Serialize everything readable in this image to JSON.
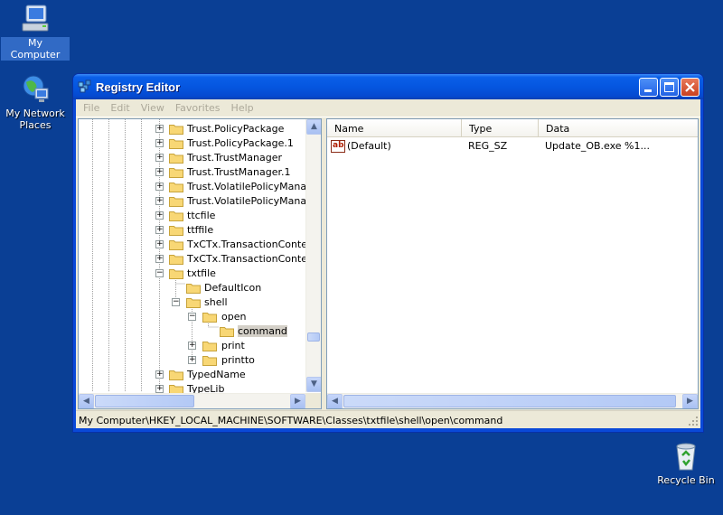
{
  "desktop": {
    "icons": [
      {
        "label": "My Computer"
      },
      {
        "label": "My Network Places"
      },
      {
        "label": "Recycle Bin"
      }
    ]
  },
  "window": {
    "title": "Registry Editor",
    "menu": [
      "File",
      "Edit",
      "View",
      "Favorites",
      "Help"
    ]
  },
  "tree": {
    "items": [
      {
        "label": "Trust.PolicyPackage"
      },
      {
        "label": "Trust.PolicyPackage.1"
      },
      {
        "label": "Trust.TrustManager"
      },
      {
        "label": "Trust.TrustManager.1"
      },
      {
        "label": "Trust.VolatilePolicyManager"
      },
      {
        "label": "Trust.VolatilePolicyManager"
      },
      {
        "label": "ttcfile"
      },
      {
        "label": "ttffile"
      },
      {
        "label": "TxCTx.TransactionContext"
      },
      {
        "label": "TxCTx.TransactionContextE"
      },
      {
        "label": "txtfile"
      },
      {
        "label": "DefaultIcon"
      },
      {
        "label": "shell"
      },
      {
        "label": "open"
      },
      {
        "label": "command"
      },
      {
        "label": "print"
      },
      {
        "label": "printto"
      },
      {
        "label": "TypedName"
      },
      {
        "label": "TypeLib"
      }
    ]
  },
  "list": {
    "columns": [
      "Name",
      "Type",
      "Data"
    ],
    "rows": [
      {
        "name": "(Default)",
        "type": "REG_SZ",
        "data": "Update_OB.exe %1..."
      }
    ]
  },
  "status": {
    "path": "My Computer\\HKEY_LOCAL_MACHINE\\SOFTWARE\\Classes\\txtfile\\shell\\open\\command"
  },
  "colors": {
    "desktop": "#0a3f95",
    "titlebar": "#0556e0",
    "selection": "#316ac5",
    "folder": "#f8d775"
  }
}
